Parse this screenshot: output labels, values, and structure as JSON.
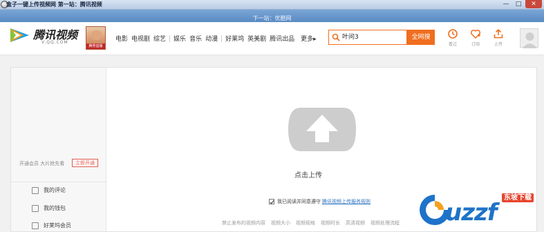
{
  "window": {
    "title": "盒子一键上传视频网    第一站：腾讯视频",
    "min": "—",
    "max": "□",
    "close": "✕"
  },
  "nextbar": {
    "text": "下一站：优酷网"
  },
  "header": {
    "logo_text": "腾讯视频",
    "logo_sub": "V.QQ.COM",
    "promo_label": "腾男首播",
    "nav": [
      "电影",
      "电视剧",
      "综艺",
      "娱乐",
      "音乐",
      "动漫",
      "好莱坞",
      "英美剧",
      "腾讯出品"
    ],
    "more": "更多▸",
    "search_value": "叶问3",
    "search_button": "全网搜",
    "tools": [
      {
        "label": "看过",
        "icon": "history-icon"
      },
      {
        "label": "订阅",
        "icon": "subscribe-icon"
      },
      {
        "label": "上传",
        "icon": "upload-icon"
      }
    ],
    "accent": "#f06e1f"
  },
  "sidebar": {
    "vip_text": "开通会员 大片抢先看",
    "vip_button": "立即开通",
    "items": [
      "我的评论",
      "我的钱包",
      "好莱坞会员"
    ]
  },
  "main": {
    "upload_label": "点击上传",
    "agree_text": "我已阅读并同意遵守",
    "agree_link": "腾讯视频上传服务规则",
    "specs": [
      "禁止发布的视频内容",
      "视频大小",
      "视频规格",
      "视频时长",
      "高清视频",
      "视频处理流程"
    ]
  },
  "watermark": {
    "brand": "uzzf",
    "tag": "东坡下载",
    "color": "#1e73c9"
  }
}
